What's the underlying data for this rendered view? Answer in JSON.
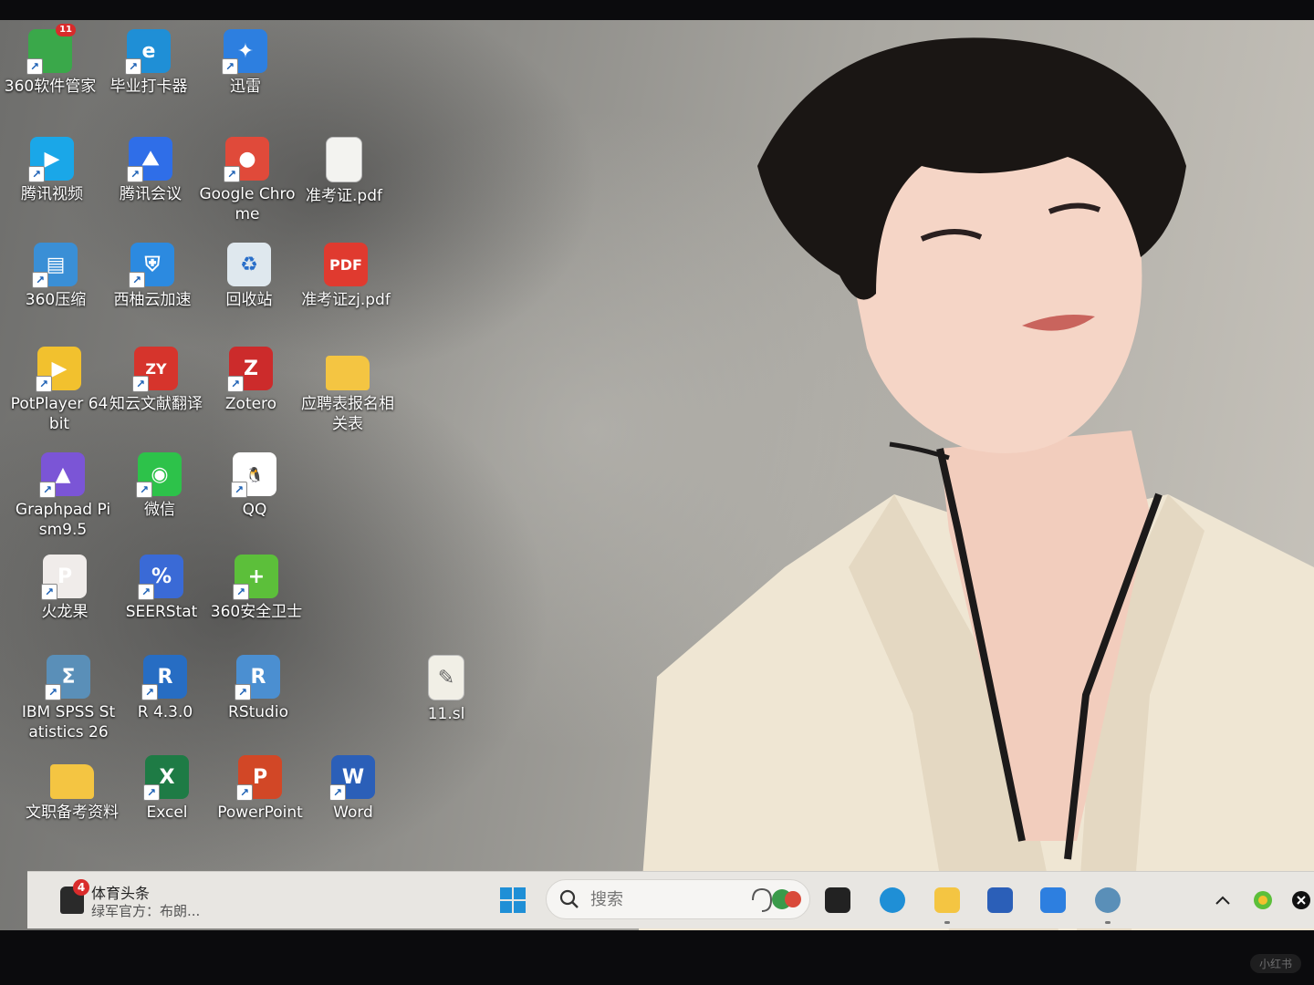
{
  "desktop": {
    "icons": [
      {
        "label": "360软件管家",
        "icon": "360-software-manager-icon",
        "color": "#3aa84a",
        "glyph": "",
        "badge": "11"
      },
      {
        "label": "毕业打卡器",
        "icon": "edge-icon",
        "color": "#1f8fd6",
        "glyph": "e"
      },
      {
        "label": "迅雷",
        "icon": "xunlei-icon",
        "color": "#2d7fe0",
        "glyph": "✦"
      },
      {
        "label": "腾讯视频",
        "icon": "tencent-video-icon",
        "color": "#1aa7e8",
        "glyph": "▶"
      },
      {
        "label": "腾讯会议",
        "icon": "tencent-meeting-icon",
        "color": "#2f6ee8",
        "glyph": "⛰"
      },
      {
        "label": "Google Chrome",
        "icon": "chrome-icon",
        "color": "#e04a3a",
        "glyph": "●"
      },
      {
        "label": "准考证.pdf",
        "icon": "document-icon",
        "color": "#f3f3f0",
        "glyph": ""
      },
      {
        "label": "360压缩",
        "icon": "360-zip-icon",
        "color": "#3a8fd6",
        "glyph": "▤"
      },
      {
        "label": "西柚云加速",
        "icon": "xiyou-accelerator-icon",
        "color": "#2c8ae0",
        "glyph": "⛨"
      },
      {
        "label": "回收站",
        "icon": "recycle-bin-icon",
        "color": "#dfe8ee",
        "glyph": "♻"
      },
      {
        "label": "准考证zj.pdf",
        "icon": "pdf-icon",
        "color": "#e03a2f",
        "glyph": "PDF"
      },
      {
        "label": "PotPlayer 64 bit",
        "icon": "potplayer-icon",
        "color": "#f2c12e",
        "glyph": "▶"
      },
      {
        "label": "知云文献翻译",
        "icon": "zhiyun-translate-icon",
        "color": "#d6342c",
        "glyph": "ZY"
      },
      {
        "label": "Zotero",
        "icon": "zotero-icon",
        "color": "#cc2b2b",
        "glyph": "Z"
      },
      {
        "label": "应聘表报名相关表",
        "icon": "folder-icon",
        "color": "#f4c542",
        "glyph": ""
      },
      {
        "label": "Graphpad Pism9.5",
        "icon": "graphpad-icon",
        "color": "#7b55d6",
        "glyph": "▲"
      },
      {
        "label": "微信",
        "icon": "wechat-icon",
        "color": "#2dc24a",
        "glyph": "◉"
      },
      {
        "label": "QQ",
        "icon": "qq-icon",
        "color": "#ffffff",
        "glyph": "🐧"
      },
      {
        "label": "火龙果",
        "icon": "pitaya-icon",
        "color": "#f0ecea",
        "glyph": "P"
      },
      {
        "label": "SEERStat",
        "icon": "seerstat-icon",
        "color": "#3a6ad6",
        "glyph": "%"
      },
      {
        "label": "360安全卫士",
        "icon": "360-security-icon",
        "color": "#5cbf3a",
        "glyph": "+"
      },
      {
        "label": "IBM SPSS Statistics 26",
        "icon": "spss-icon",
        "color": "#5a8fb8",
        "glyph": "Σ"
      },
      {
        "label": "R 4.3.0",
        "icon": "r-language-icon",
        "color": "#276dc3",
        "glyph": "R"
      },
      {
        "label": "RStudio",
        "icon": "rstudio-icon",
        "color": "#4b8fd1",
        "glyph": "R"
      },
      {
        "label": "11.sl",
        "icon": "script-file-icon",
        "color": "#f1efe6",
        "glyph": "✎"
      },
      {
        "label": "文职备考资料",
        "icon": "folder-icon",
        "color": "#f4c542",
        "glyph": ""
      },
      {
        "label": "Excel",
        "icon": "excel-icon",
        "color": "#1e7b45",
        "glyph": "X"
      },
      {
        "label": "PowerPoint",
        "icon": "powerpoint-icon",
        "color": "#d24726",
        "glyph": "P"
      },
      {
        "label": "Word",
        "icon": "word-icon",
        "color": "#2b5fb8",
        "glyph": "W"
      }
    ]
  },
  "taskbar": {
    "news": {
      "badge": "4",
      "title": "体育头条",
      "subtitle": "绿军官方：布朗..."
    },
    "start_icon": "windows-start-icon",
    "search": {
      "placeholder": "搜索"
    },
    "apps": [
      {
        "name": "task-view-icon",
        "color": "#222222"
      },
      {
        "name": "edge-icon",
        "color": "#1f8fd6"
      },
      {
        "name": "file-explorer-icon",
        "color": "#f4c542"
      },
      {
        "name": "microsoft-store-icon",
        "color": "#2b5fb8"
      },
      {
        "name": "xunlei-icon",
        "color": "#2d7fe0"
      },
      {
        "name": "spss-icon",
        "color": "#5a8fb8"
      }
    ],
    "tray": [
      "chevron-up-icon",
      "360-security-icon",
      "close-icon"
    ]
  },
  "watermark": "小红书"
}
